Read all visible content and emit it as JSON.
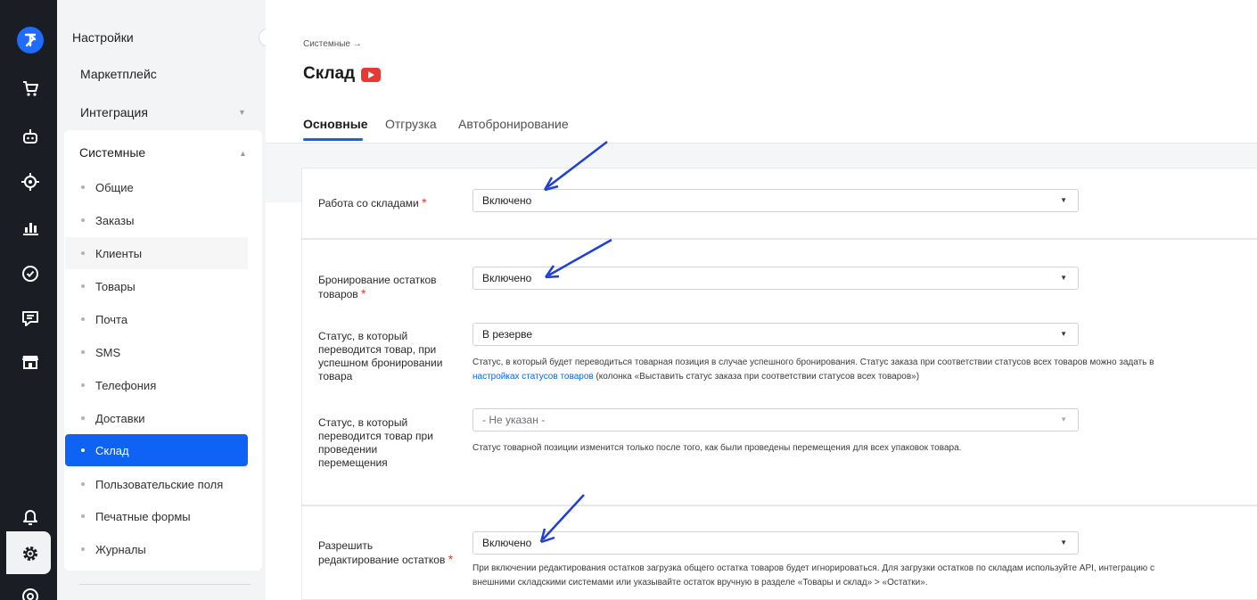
{
  "rail": {
    "icons": [
      "logo-icon",
      "cart-icon",
      "robot-icon",
      "target-icon",
      "chart-icon",
      "check-circle-icon",
      "chat-icon",
      "store-icon",
      "bell-icon",
      "gear-icon",
      "support-icon"
    ]
  },
  "sidebar": {
    "title": "Настройки",
    "top_items": [
      "Маркетплейс",
      "Интеграция",
      "Системные"
    ],
    "items": [
      {
        "label": "Общие"
      },
      {
        "label": "Заказы"
      },
      {
        "label": "Клиенты"
      },
      {
        "label": "Товары"
      },
      {
        "label": "Почта"
      },
      {
        "label": "SMS"
      },
      {
        "label": "Телефония"
      },
      {
        "label": "Доставки"
      },
      {
        "label": "Склад",
        "active": true
      },
      {
        "label": "Пользовательские поля"
      },
      {
        "label": "Печатные формы"
      },
      {
        "label": "Журналы"
      }
    ]
  },
  "header": {
    "breadcrumb": "Системные →",
    "title": "Склад"
  },
  "tabs": [
    {
      "label": "Основные",
      "active": true
    },
    {
      "label": "Отгрузка"
    },
    {
      "label": "Автобронирование"
    }
  ],
  "form": {
    "warehouses": {
      "label": "Работа со складами",
      "value": "Включено"
    },
    "reserve": {
      "label_line1": "Бронирование остатков",
      "label_line2": "товаров",
      "value": "Включено"
    },
    "status_reserve": {
      "label_lines": [
        "Статус, в который",
        "переводится товар, при",
        "успешном бронировании",
        "товара"
      ],
      "value": "В резерве",
      "hint_before": "Статус, в который будет переводиться товарная позиция в случае успешного бронирования. Статус заказа при соответствии статусов всех товаров можно задать в",
      "hint_link": "настройках статусов товаров",
      "hint_after": " (колонка «Выставить статус заказа при соответствии статусов всех товаров»)"
    },
    "status_move": {
      "label_lines": [
        "Статус, в который",
        "переводится товар при",
        "проведении",
        "перемещения"
      ],
      "value": "- Не указан -",
      "hint": "Статус товарной позиции изменится только после того, как были проведены перемещения для всех упаковок товара."
    },
    "edit_stock": {
      "label_line1": "Разрешить",
      "label_line2": "редактирование остатков",
      "value": "Включено",
      "hint_line1": "При включении редактирования остатков загрузка общего остатка товаров будет игнорироваться. Для загрузки остатков по складам используйте API, интеграцию с",
      "hint_line2": "внешними складскими системами или указывайте остаток вручную в разделе «Товары и склад» > «Остатки»."
    }
  },
  "colors": {
    "accent": "#0e62f4",
    "rail": "#1a1d23",
    "required": "#e53935",
    "annotation": "#1f3fd6"
  }
}
